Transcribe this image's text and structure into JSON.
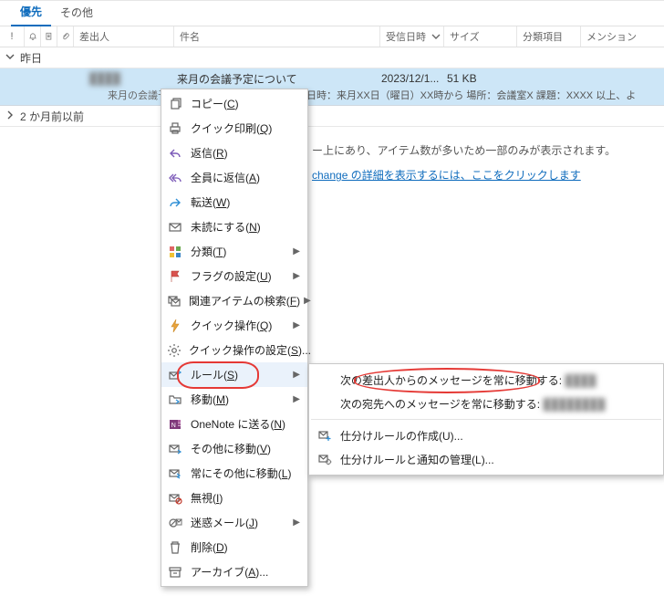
{
  "tabs": {
    "focused": "優先",
    "other": "その他"
  },
  "columns": {
    "sender": "差出人",
    "subject": "件名",
    "received": "受信日時",
    "size": "サイズ",
    "category": "分類項目",
    "mention": "メンション"
  },
  "groups": {
    "yesterday": "昨日",
    "older": "2 か月前以前"
  },
  "mail": {
    "sender_blur": "████",
    "subject": "来月の会議予定について",
    "date": "2023/12/1...",
    "size": "51 KB",
    "preview_label": "来月の会議予定",
    "preview_body": "日時：来月XX日（曜日）XX時から  場所：会議室X  課題：XXXX  以上、よ"
  },
  "info": {
    "line1": "ー上にあり、アイテム数が多いため一部のみが表示されます。",
    "link": "change の詳細を表示するには、ここをクリックします"
  },
  "menu": {
    "copy": {
      "t": "コピー(",
      "k": "C",
      "s": ")"
    },
    "quickprint": {
      "t": "クイック印刷(",
      "k": "Q",
      "s": ")"
    },
    "reply": {
      "t": "返信(",
      "k": "R",
      "s": ")"
    },
    "replyall": {
      "t": "全員に返信(",
      "k": "A",
      "s": ")"
    },
    "forward": {
      "t": "転送(",
      "k": "W",
      "s": ")"
    },
    "unread": {
      "t": "未読にする(",
      "k": "N",
      "s": ")"
    },
    "categorize": {
      "t": "分類(",
      "k": "T",
      "s": ")"
    },
    "flag": {
      "t": "フラグの設定(",
      "k": "U",
      "s": ")"
    },
    "related": {
      "t": "関連アイテムの検索(",
      "k": "F",
      "s": ")"
    },
    "quickop": {
      "t": "クイック操作(",
      "k": "Q",
      "s": ")"
    },
    "quickopset": {
      "t": "クイック操作の設定(",
      "k": "S",
      "s": ")..."
    },
    "rules": {
      "t": "ルール(",
      "k": "S",
      "s": ")"
    },
    "move": {
      "t": "移動(",
      "k": "M",
      "s": ")"
    },
    "onenote": {
      "t": "OneNote に送る(",
      "k": "N",
      "s": ")"
    },
    "moveother": {
      "t": "その他に移動(",
      "k": "V",
      "s": ")"
    },
    "movealways": {
      "t": "常にその他に移動(",
      "k": "L",
      "s": ")"
    },
    "ignore": {
      "t": "無視(",
      "k": "I",
      "s": ")"
    },
    "junk": {
      "t": "迷惑メール(",
      "k": "J",
      "s": ")"
    },
    "delete": {
      "t": "削除(",
      "k": "D",
      "s": ")"
    },
    "archive": {
      "t": "アーカイブ(",
      "k": "A",
      "s": ")..."
    }
  },
  "submenu": {
    "from": "次の差出人からのメッセージを常に移動する:",
    "from_name": "████",
    "to": "次の宛先へのメッセージを常に移動する:",
    "to_name": "████████",
    "create": {
      "t": "仕分けルールの作成(",
      "k": "U",
      "s": ")..."
    },
    "manage": {
      "t": "仕分けルールと通知の管理(",
      "k": "L",
      "s": ")..."
    }
  }
}
